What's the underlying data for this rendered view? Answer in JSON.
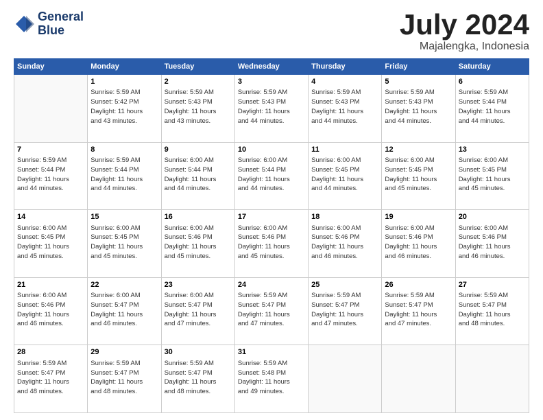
{
  "logo": {
    "line1": "General",
    "line2": "Blue"
  },
  "title": "July 2024",
  "location": "Majalengka, Indonesia",
  "days_header": [
    "Sunday",
    "Monday",
    "Tuesday",
    "Wednesday",
    "Thursday",
    "Friday",
    "Saturday"
  ],
  "weeks": [
    [
      {
        "day": "",
        "info": ""
      },
      {
        "day": "1",
        "info": "Sunrise: 5:59 AM\nSunset: 5:42 PM\nDaylight: 11 hours\nand 43 minutes."
      },
      {
        "day": "2",
        "info": "Sunrise: 5:59 AM\nSunset: 5:43 PM\nDaylight: 11 hours\nand 43 minutes."
      },
      {
        "day": "3",
        "info": "Sunrise: 5:59 AM\nSunset: 5:43 PM\nDaylight: 11 hours\nand 44 minutes."
      },
      {
        "day": "4",
        "info": "Sunrise: 5:59 AM\nSunset: 5:43 PM\nDaylight: 11 hours\nand 44 minutes."
      },
      {
        "day": "5",
        "info": "Sunrise: 5:59 AM\nSunset: 5:43 PM\nDaylight: 11 hours\nand 44 minutes."
      },
      {
        "day": "6",
        "info": "Sunrise: 5:59 AM\nSunset: 5:44 PM\nDaylight: 11 hours\nand 44 minutes."
      }
    ],
    [
      {
        "day": "7",
        "info": "Sunrise: 5:59 AM\nSunset: 5:44 PM\nDaylight: 11 hours\nand 44 minutes."
      },
      {
        "day": "8",
        "info": "Sunrise: 5:59 AM\nSunset: 5:44 PM\nDaylight: 11 hours\nand 44 minutes."
      },
      {
        "day": "9",
        "info": "Sunrise: 6:00 AM\nSunset: 5:44 PM\nDaylight: 11 hours\nand 44 minutes."
      },
      {
        "day": "10",
        "info": "Sunrise: 6:00 AM\nSunset: 5:44 PM\nDaylight: 11 hours\nand 44 minutes."
      },
      {
        "day": "11",
        "info": "Sunrise: 6:00 AM\nSunset: 5:45 PM\nDaylight: 11 hours\nand 44 minutes."
      },
      {
        "day": "12",
        "info": "Sunrise: 6:00 AM\nSunset: 5:45 PM\nDaylight: 11 hours\nand 45 minutes."
      },
      {
        "day": "13",
        "info": "Sunrise: 6:00 AM\nSunset: 5:45 PM\nDaylight: 11 hours\nand 45 minutes."
      }
    ],
    [
      {
        "day": "14",
        "info": "Sunrise: 6:00 AM\nSunset: 5:45 PM\nDaylight: 11 hours\nand 45 minutes."
      },
      {
        "day": "15",
        "info": "Sunrise: 6:00 AM\nSunset: 5:45 PM\nDaylight: 11 hours\nand 45 minutes."
      },
      {
        "day": "16",
        "info": "Sunrise: 6:00 AM\nSunset: 5:46 PM\nDaylight: 11 hours\nand 45 minutes."
      },
      {
        "day": "17",
        "info": "Sunrise: 6:00 AM\nSunset: 5:46 PM\nDaylight: 11 hours\nand 45 minutes."
      },
      {
        "day": "18",
        "info": "Sunrise: 6:00 AM\nSunset: 5:46 PM\nDaylight: 11 hours\nand 46 minutes."
      },
      {
        "day": "19",
        "info": "Sunrise: 6:00 AM\nSunset: 5:46 PM\nDaylight: 11 hours\nand 46 minutes."
      },
      {
        "day": "20",
        "info": "Sunrise: 6:00 AM\nSunset: 5:46 PM\nDaylight: 11 hours\nand 46 minutes."
      }
    ],
    [
      {
        "day": "21",
        "info": "Sunrise: 6:00 AM\nSunset: 5:46 PM\nDaylight: 11 hours\nand 46 minutes."
      },
      {
        "day": "22",
        "info": "Sunrise: 6:00 AM\nSunset: 5:47 PM\nDaylight: 11 hours\nand 46 minutes."
      },
      {
        "day": "23",
        "info": "Sunrise: 6:00 AM\nSunset: 5:47 PM\nDaylight: 11 hours\nand 47 minutes."
      },
      {
        "day": "24",
        "info": "Sunrise: 5:59 AM\nSunset: 5:47 PM\nDaylight: 11 hours\nand 47 minutes."
      },
      {
        "day": "25",
        "info": "Sunrise: 5:59 AM\nSunset: 5:47 PM\nDaylight: 11 hours\nand 47 minutes."
      },
      {
        "day": "26",
        "info": "Sunrise: 5:59 AM\nSunset: 5:47 PM\nDaylight: 11 hours\nand 47 minutes."
      },
      {
        "day": "27",
        "info": "Sunrise: 5:59 AM\nSunset: 5:47 PM\nDaylight: 11 hours\nand 48 minutes."
      }
    ],
    [
      {
        "day": "28",
        "info": "Sunrise: 5:59 AM\nSunset: 5:47 PM\nDaylight: 11 hours\nand 48 minutes."
      },
      {
        "day": "29",
        "info": "Sunrise: 5:59 AM\nSunset: 5:47 PM\nDaylight: 11 hours\nand 48 minutes."
      },
      {
        "day": "30",
        "info": "Sunrise: 5:59 AM\nSunset: 5:47 PM\nDaylight: 11 hours\nand 48 minutes."
      },
      {
        "day": "31",
        "info": "Sunrise: 5:59 AM\nSunset: 5:48 PM\nDaylight: 11 hours\nand 49 minutes."
      },
      {
        "day": "",
        "info": ""
      },
      {
        "day": "",
        "info": ""
      },
      {
        "day": "",
        "info": ""
      }
    ]
  ]
}
